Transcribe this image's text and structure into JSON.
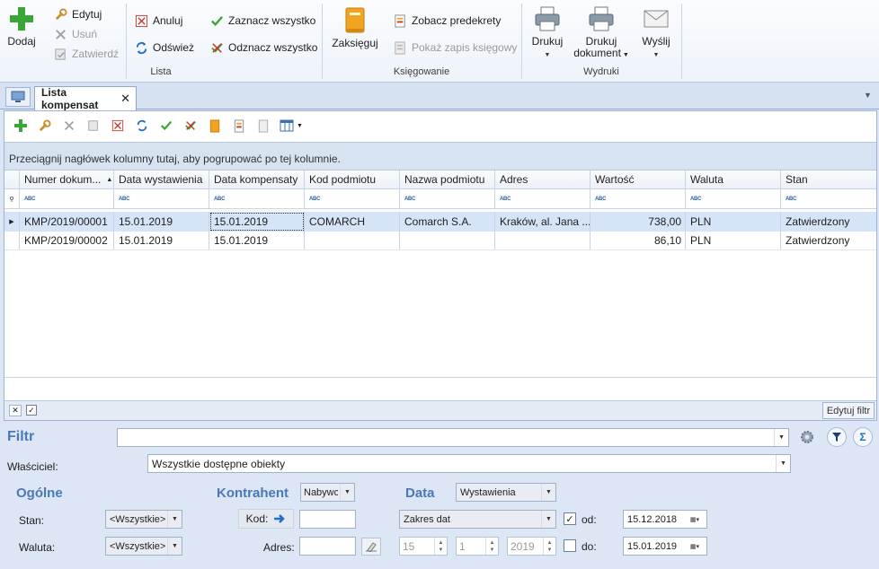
{
  "ribbon": {
    "lista": {
      "add": "Dodaj",
      "edit": "Edytuj",
      "delete": "Usuń",
      "approve": "Zatwierdź",
      "cancel": "Anuluj",
      "refresh": "Odśwież",
      "select_all": "Zaznacz wszystko",
      "deselect_all": "Odznacz wszystko",
      "group_label": "Lista"
    },
    "ksiegowanie": {
      "post": "Zaksięguj",
      "show_predecrees": "Zobacz predekrety",
      "show_entry": "Pokaż zapis księgowy",
      "group_label": "Księgowanie"
    },
    "wydruki": {
      "print": "Drukuj",
      "print_doc_line1": "Drukuj",
      "print_doc_line2": "dokument",
      "send": "Wyślij",
      "group_label": "Wydruki"
    }
  },
  "tabs": {
    "active": "Lista kompensat"
  },
  "grid": {
    "group_hint": "Przeciągnij nagłówek kolumny tutaj, aby pogrupować po tej kolumnie.",
    "columns": [
      "Numer dokum...",
      "Data wystawienia",
      "Data kompensaty",
      "Kod podmiotu",
      "Nazwa podmiotu",
      "Adres",
      "Wartość",
      "Waluta",
      "Stan"
    ],
    "filter_placeholder": "ABC",
    "rows": [
      [
        "KMP/2019/00001",
        "15.01.2019",
        "15.01.2019",
        "COMARCH",
        "Comarch S.A.",
        "Kraków, al. Jana ...",
        "738,00",
        "PLN",
        "Zatwierdzony"
      ],
      [
        "KMP/2019/00002",
        "15.01.2019",
        "15.01.2019",
        "",
        "",
        "",
        "86,10",
        "PLN",
        "Zatwierdzony"
      ]
    ],
    "edit_filter": "Edytuj filtr"
  },
  "filter": {
    "title": "Filtr",
    "filter_value": "",
    "owner_label": "Właściciel:",
    "owner_value": "Wszystkie dostępne obiekty",
    "general_title": "Ogólne",
    "status_label": "Stan:",
    "status_value": "<Wszystkie>",
    "currency_label": "Waluta:",
    "currency_value": "<Wszystkie>",
    "contractor_title": "Kontrahent",
    "contractor_type": "Nabywca",
    "code_label": "Kod:",
    "code_value": "",
    "address_label": "Adres:",
    "address_value": "",
    "date_title": "Data",
    "date_type": "Wystawienia",
    "date_range": "Zakres dat",
    "day": "15",
    "month": "1",
    "year": "2019",
    "from_label": "od:",
    "from_value": "15.12.2018",
    "to_label": "do:",
    "to_value": "15.01.2019"
  }
}
